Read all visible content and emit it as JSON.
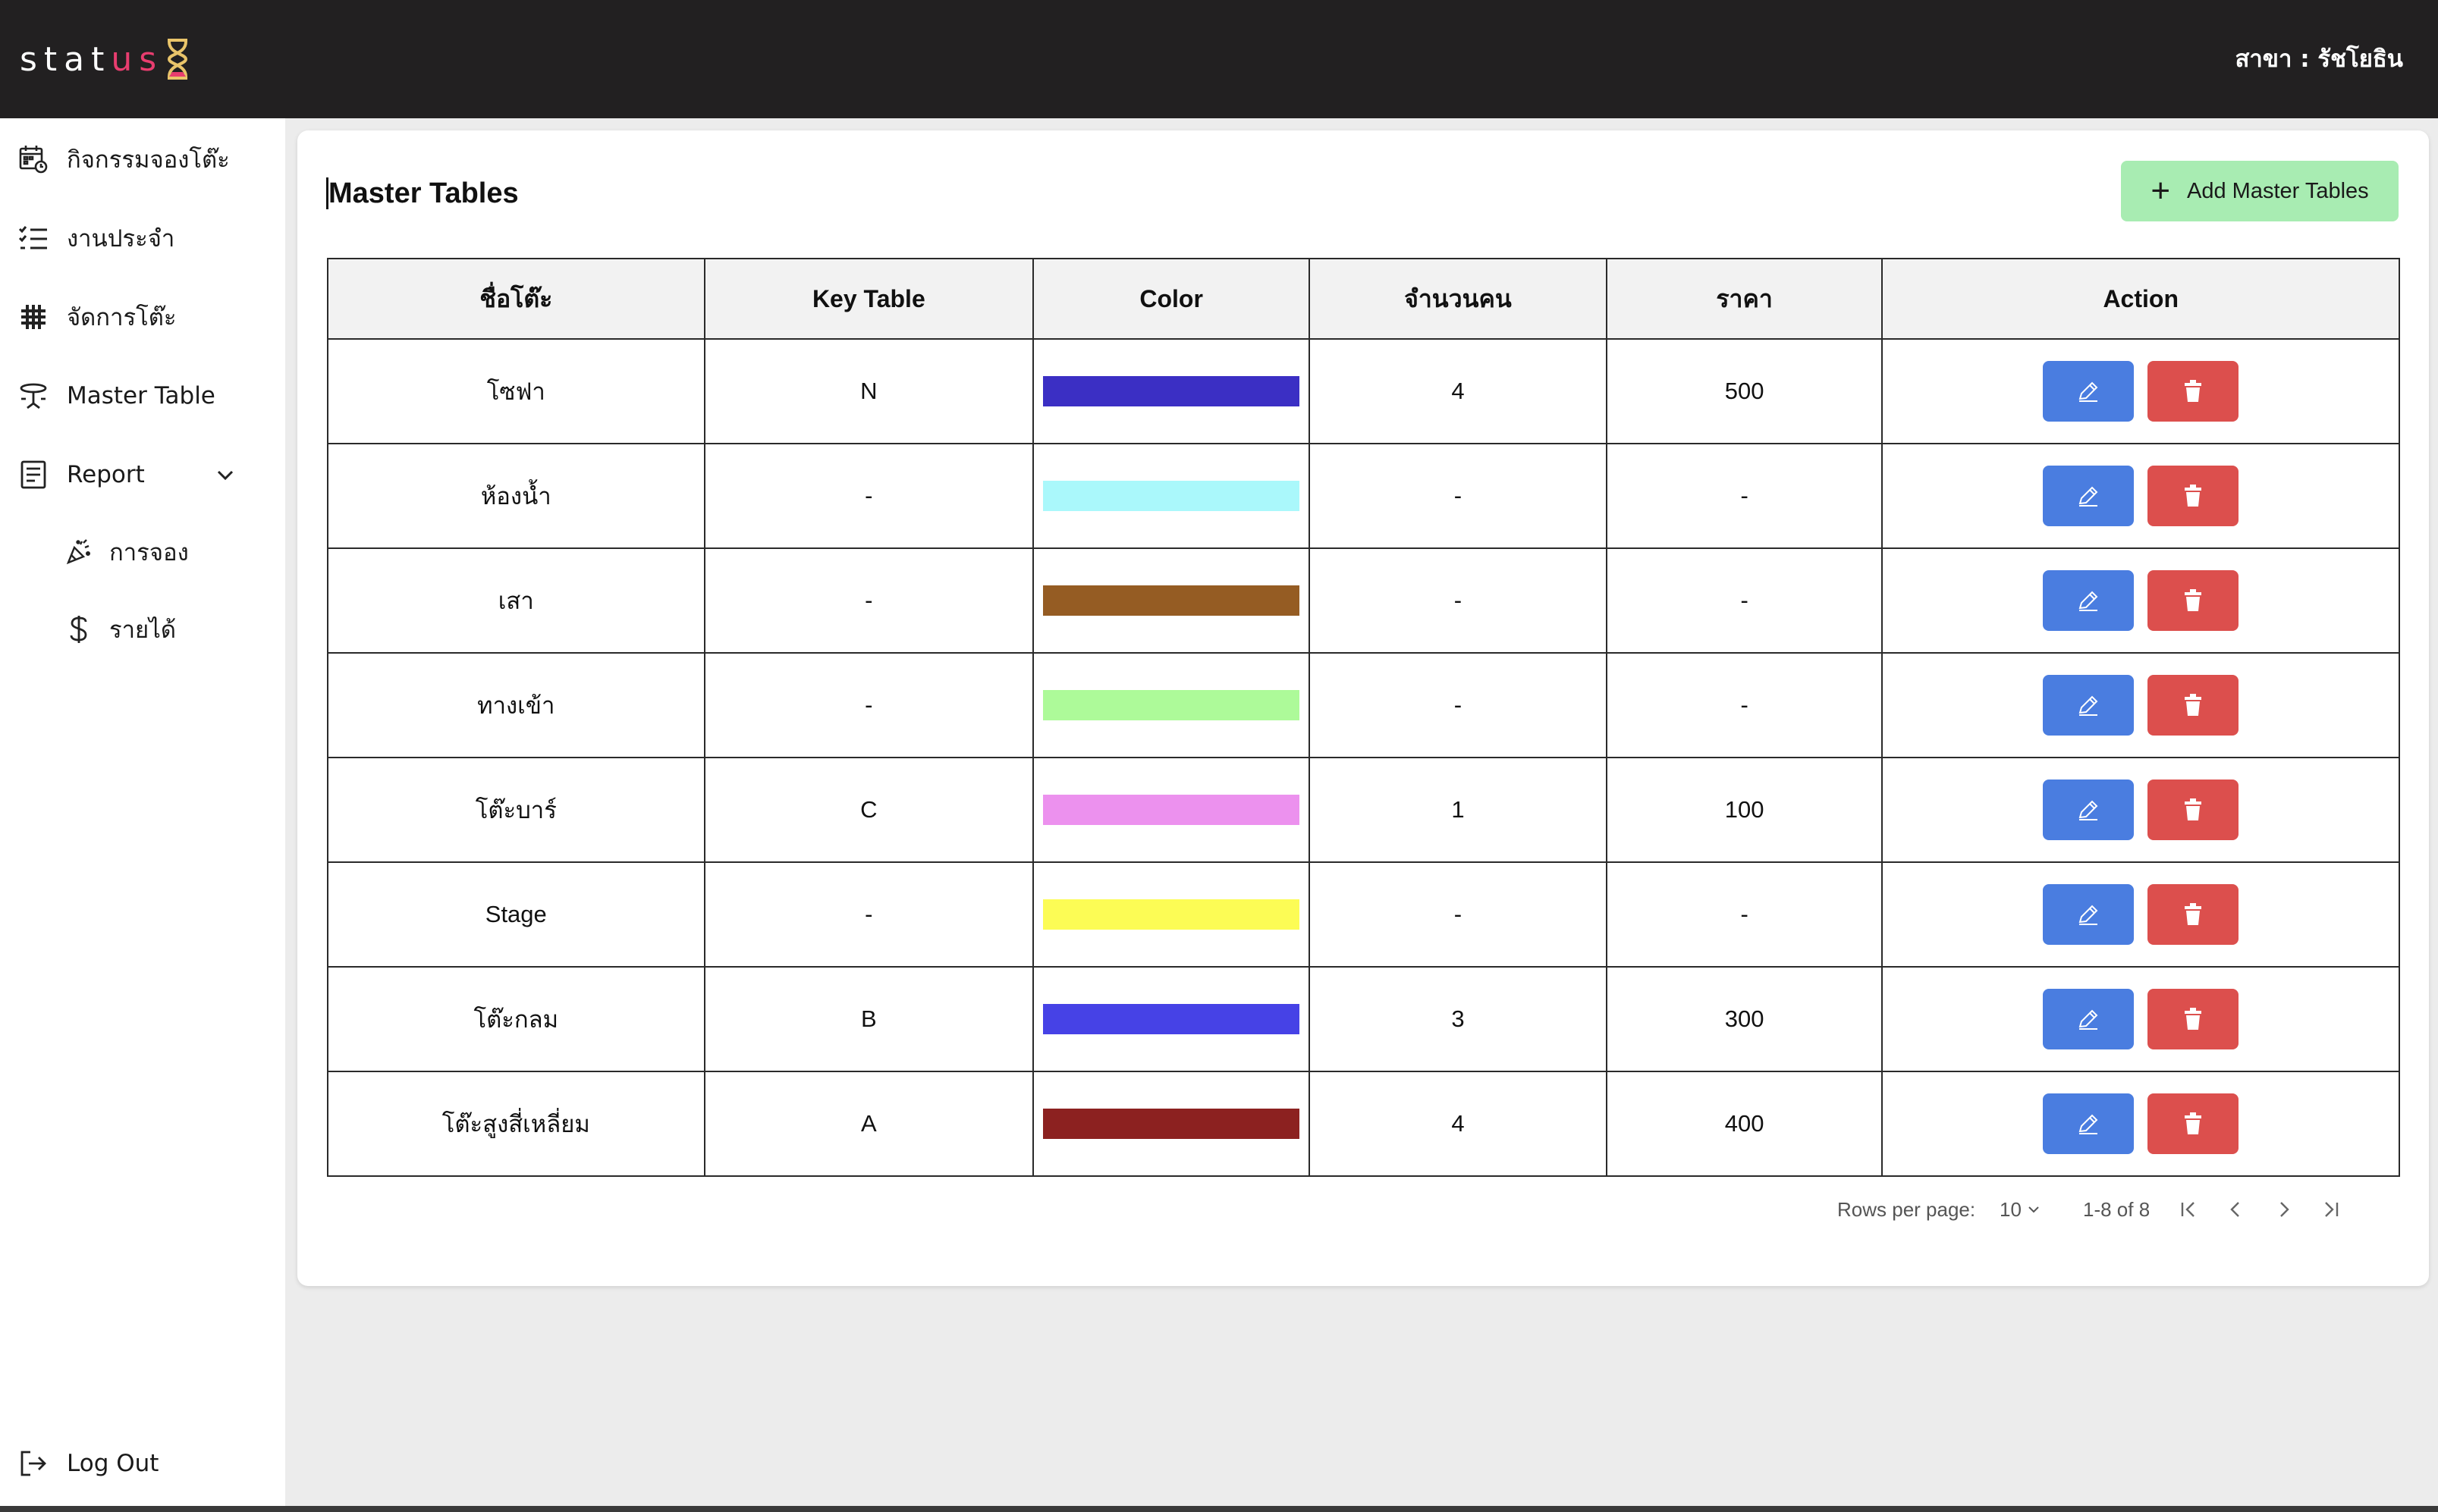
{
  "header": {
    "logo_text_main": "stat",
    "logo_text_accent": "us",
    "branch_label": "สาขา : รัชโยธิน"
  },
  "sidebar": {
    "items": [
      {
        "label": "กิจกรรมจองโต๊ะ",
        "icon": "calendar-clock-icon"
      },
      {
        "label": "งานประจำ",
        "icon": "checklist-icon"
      },
      {
        "label": "จัดการโต๊ะ",
        "icon": "grid-hash-icon"
      },
      {
        "label": "Master Table",
        "icon": "round-table-icon"
      },
      {
        "label": "Report",
        "icon": "report-icon"
      }
    ],
    "report_sub": [
      {
        "label": "การจอง",
        "icon": "party-popper-icon"
      },
      {
        "label": "รายได้",
        "icon": "dollar-icon"
      }
    ],
    "logout_label": "Log Out"
  },
  "main": {
    "title": "Master Tables",
    "add_button_label": "Add Master Tables",
    "columns": [
      "ชื่อโต๊ะ",
      "Key Table",
      "Color",
      "จำนวนคน",
      "ราคา",
      "Action"
    ],
    "rows": [
      {
        "name": "โซฟา",
        "key": "N",
        "color": "#3b2fc4",
        "people": "4",
        "price": "500"
      },
      {
        "name": "ห้องน้ำ",
        "key": "-",
        "color": "#aaf8fb",
        "people": "-",
        "price": "-"
      },
      {
        "name": "เสา",
        "key": "-",
        "color": "#955c23",
        "people": "-",
        "price": "-"
      },
      {
        "name": "ทางเข้า",
        "key": "-",
        "color": "#adfa99",
        "people": "-",
        "price": "-"
      },
      {
        "name": "โต๊ะบาร์",
        "key": "C",
        "color": "#ec91ee",
        "people": "1",
        "price": "100"
      },
      {
        "name": "Stage",
        "key": "-",
        "color": "#fcfc55",
        "people": "-",
        "price": "-"
      },
      {
        "name": "โต๊ะกลม",
        "key": "B",
        "color": "#4642e6",
        "people": "3",
        "price": "300"
      },
      {
        "name": "โต๊ะสูงสี่เหลี่ยม",
        "key": "A",
        "color": "#8c2120",
        "people": "4",
        "price": "400"
      }
    ]
  },
  "pagination": {
    "rows_per_page_label": "Rows per page:",
    "rows_per_page_value": "10",
    "range_text": "1-8 of 8"
  },
  "colors": {
    "topbar": "#222021",
    "logo_accent": "#e83d6f",
    "add_button": "#a8ecb2",
    "edit_button": "#4a7de0",
    "delete_button": "#dc4f4d"
  }
}
